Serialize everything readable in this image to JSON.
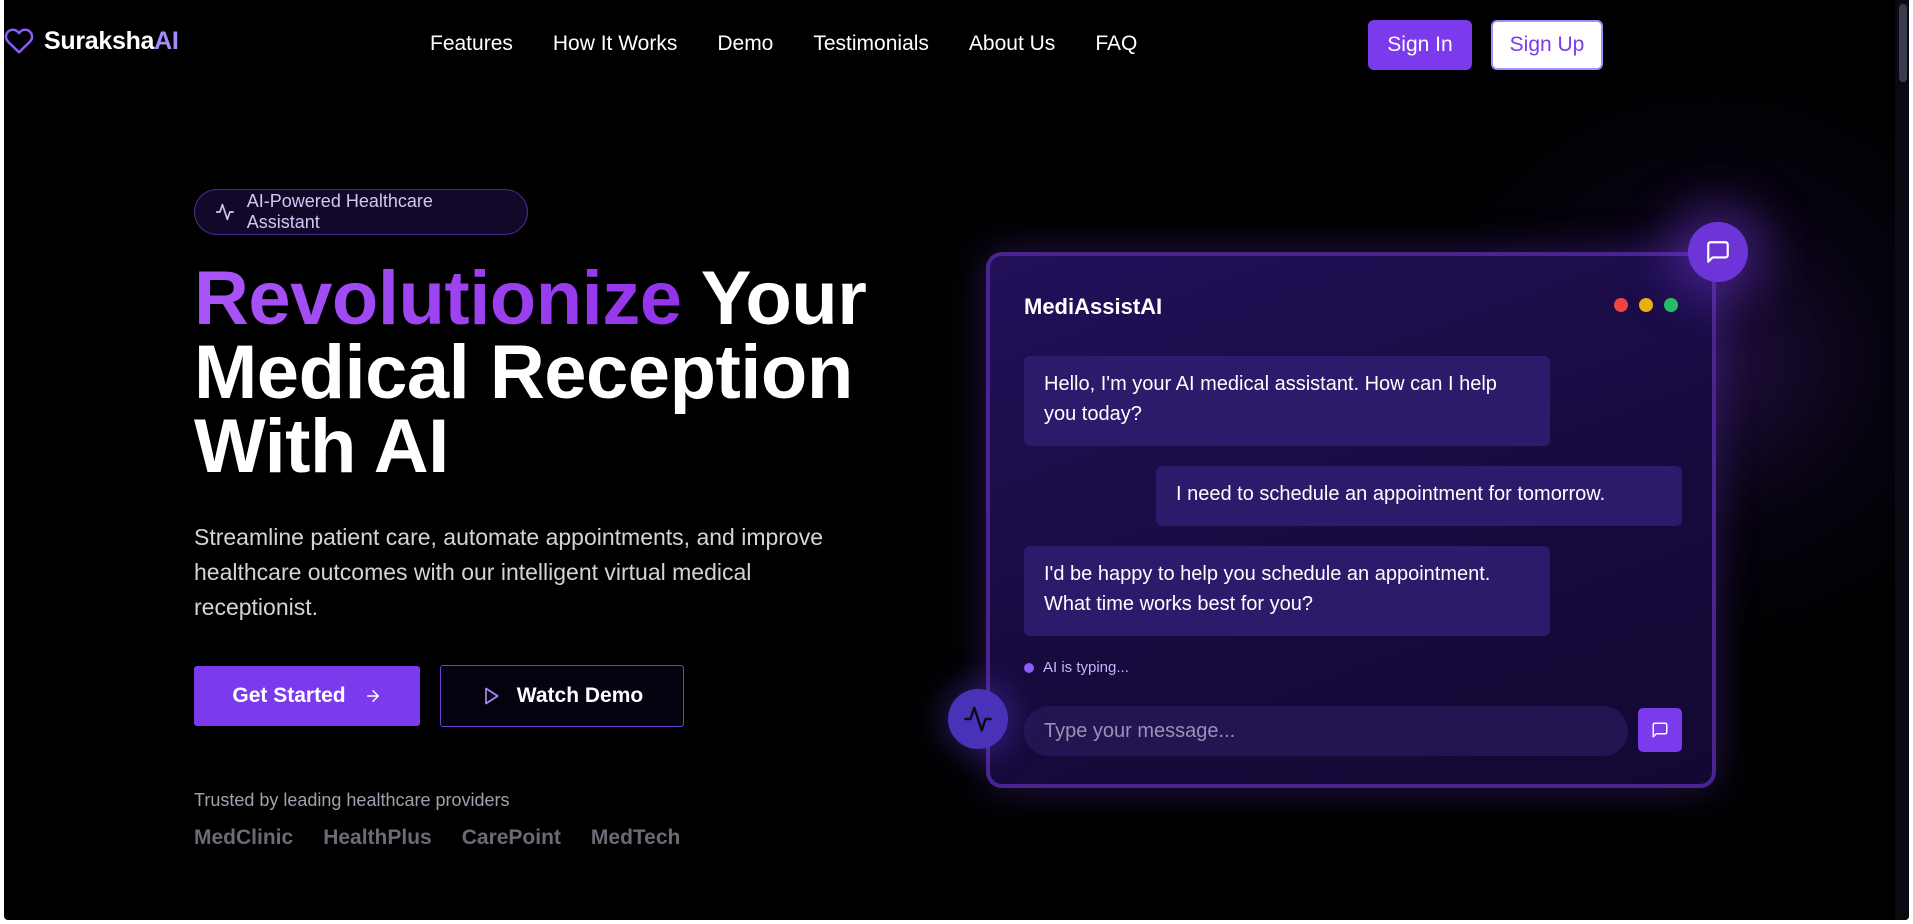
{
  "brand": {
    "name_prefix": "Suraksha",
    "name_suffix": "AI"
  },
  "nav": {
    "links": [
      "Features",
      "How It Works",
      "Demo",
      "Testimonials",
      "About Us",
      "FAQ"
    ],
    "sign_in": "Sign In",
    "sign_up": "Sign Up"
  },
  "hero": {
    "badge": "AI-Powered Healthcare Assistant",
    "headline_accent": "Revolutionize",
    "headline_line1_rest": " Your",
    "headline_line2": "Medical Reception",
    "headline_line3": "With AI",
    "subtext": "Streamline patient care, automate appointments, and improve healthcare outcomes with our intelligent virtual medical receptionist.",
    "cta_primary": "Get Started",
    "cta_secondary": "Watch Demo",
    "trusted_label": "Trusted by leading healthcare providers",
    "partners": [
      "MedClinic",
      "HealthPlus",
      "CarePoint",
      "MedTech"
    ]
  },
  "chat": {
    "title": "MediAssistAI",
    "messages": [
      {
        "from": "ai",
        "text": "Hello, I'm your AI medical assistant. How can I help you today?"
      },
      {
        "from": "user",
        "text": "I need to schedule an appointment for tomorrow."
      },
      {
        "from": "ai",
        "text": "I'd be happy to help you schedule an appointment. What time works best for you?"
      }
    ],
    "typing": "AI is typing...",
    "input_placeholder": "Type your message..."
  },
  "colors": {
    "accent": "#7c3aed",
    "accent_light": "#a78bfa",
    "background": "#000000",
    "dot_red": "#ef4444",
    "dot_yellow": "#eab308",
    "dot_green": "#22c55e"
  },
  "icons": {
    "logo": "heart-icon",
    "badge": "activity-pulse-icon",
    "cta_primary": "arrow-right-icon",
    "cta_secondary": "play-icon",
    "send": "message-square-icon",
    "float_chat": "message-square-icon",
    "float_pulse": "activity-pulse-icon"
  }
}
